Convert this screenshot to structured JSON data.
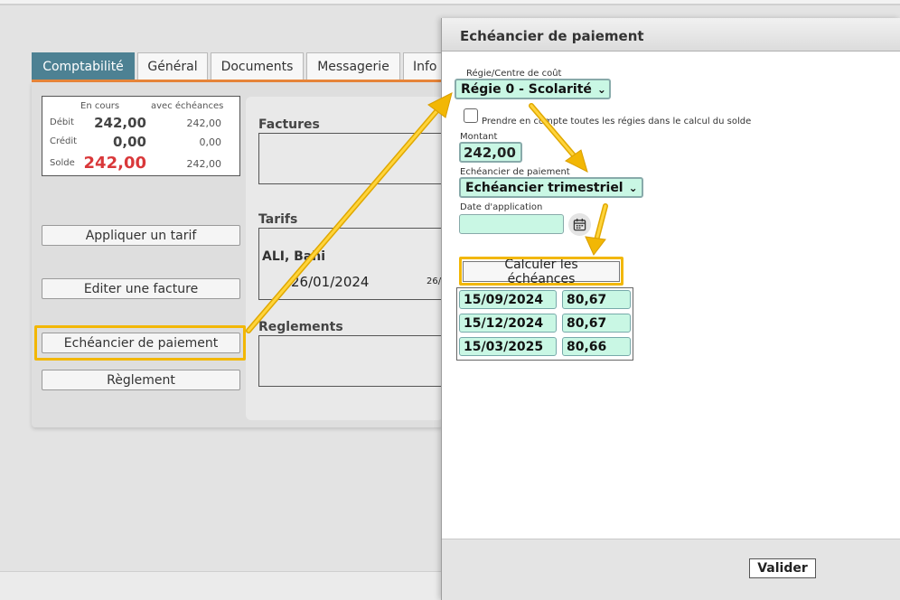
{
  "tabs": [
    {
      "label": "Comptabilité",
      "active": true
    },
    {
      "label": "Général"
    },
    {
      "label": "Documents"
    },
    {
      "label": "Messagerie"
    },
    {
      "label": "Info"
    }
  ],
  "balance": {
    "col_current": "En cours",
    "col_schedule": "avec échéances",
    "rows": [
      {
        "label": "Débit",
        "current": "242,00",
        "schedule": "242,00"
      },
      {
        "label": "Crédit",
        "current": "0,00",
        "schedule": "0,00"
      },
      {
        "label": "Solde",
        "current": "242,00",
        "schedule": "242,00"
      }
    ]
  },
  "left_buttons": {
    "apply_tariff": "Appliquer un tarif",
    "edit_invoice": "Editer une facture",
    "payment_schedule": "Echéancier de paiement",
    "payment": "Règlement"
  },
  "sections": {
    "invoices": "Factures",
    "tariffs": "Tarifs",
    "payments": "Reglements"
  },
  "tariff_entry": {
    "name": "ALI, Bahi",
    "date": "26/01/2024",
    "date2": "26/"
  },
  "modal": {
    "title": "Echéancier de paiement",
    "regie_label": "Régie/Centre de coût",
    "regie_value": "Régie 0 - Scolarité",
    "checkbox_label": "Prendre en compte toutes les régies dans le calcul du solde",
    "amount_label": "Montant",
    "amount_value": "242,00",
    "schedule_label": "Echéancier de paiement",
    "schedule_value": "Echéancier trimestriel",
    "date_label": "Date d'application",
    "date_value": "",
    "calc_button": "Calculer les échéances",
    "installments": [
      {
        "date": "15/09/2024",
        "amount": "80,67"
      },
      {
        "date": "15/12/2024",
        "amount": "80,67"
      },
      {
        "date": "15/03/2025",
        "amount": "80,66"
      }
    ],
    "validate_button": "Valider"
  },
  "colors": {
    "tab_active": "#4d8193",
    "tab_underline": "#e8853a",
    "field_bg": "#c9f7e4",
    "solde_red": "#d9383a",
    "highlight": "#f2b705"
  },
  "icons": {
    "calendar": "calendar-icon",
    "chevron": "chevron-down-icon"
  }
}
